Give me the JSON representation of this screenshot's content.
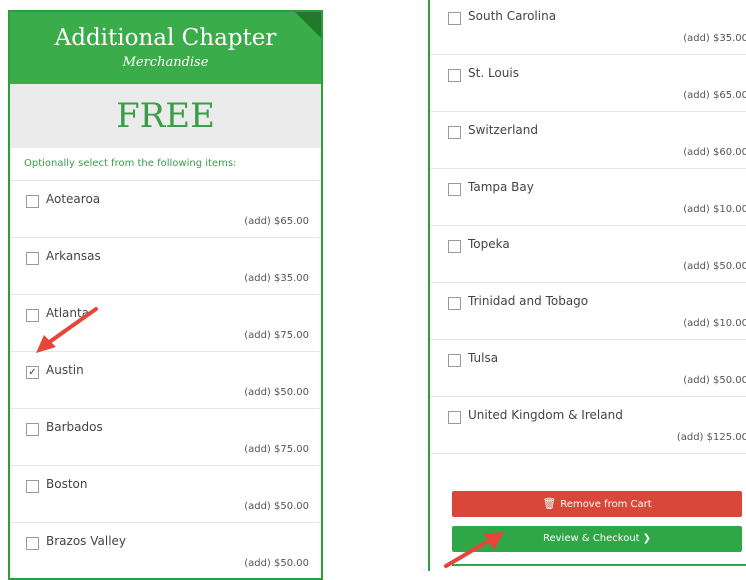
{
  "left": {
    "title": "Additional Chapter",
    "subtitle": "Merchandise",
    "price": "FREE",
    "instructions": "Optionally select from the following items:",
    "items": [
      {
        "name": "Aotearoa",
        "price": "(add) $65.00",
        "checked": false
      },
      {
        "name": "Arkansas",
        "price": "(add) $35.00",
        "checked": false
      },
      {
        "name": "Atlanta",
        "price": "(add) $75.00",
        "checked": false
      },
      {
        "name": "Austin",
        "price": "(add) $50.00",
        "checked": true
      },
      {
        "name": "Barbados",
        "price": "(add) $75.00",
        "checked": false
      },
      {
        "name": "Boston",
        "price": "(add) $50.00",
        "checked": false
      },
      {
        "name": "Brazos Valley",
        "price": "(add) $50.00",
        "checked": false
      }
    ]
  },
  "right": {
    "items": [
      {
        "name": "South Carolina",
        "price": "(add) $35.00",
        "checked": false
      },
      {
        "name": "St. Louis",
        "price": "(add) $65.00",
        "checked": false
      },
      {
        "name": "Switzerland",
        "price": "(add) $60.00",
        "checked": false
      },
      {
        "name": "Tampa Bay",
        "price": "(add) $10.00",
        "checked": false
      },
      {
        "name": "Topeka",
        "price": "(add) $50.00",
        "checked": false
      },
      {
        "name": "Trinidad and Tobago",
        "price": "(add) $10.00",
        "checked": false
      },
      {
        "name": "Tulsa",
        "price": "(add) $50.00",
        "checked": false
      },
      {
        "name": "United Kingdom & Ireland",
        "price": "(add) $125.00",
        "checked": false
      }
    ],
    "remove_label": "Remove from Cart",
    "review_label": "Review & Checkout"
  },
  "icons": {
    "remove": "trash-icon",
    "review": "chevron-right-icon",
    "annotation": "red-arrow-icon"
  },
  "colors": {
    "brand_green": "#3aac4a",
    "price_green": "#3a9d47",
    "remove_red": "#d9463a",
    "review_green": "#2fa747",
    "arrow_red": "#e8443a"
  }
}
